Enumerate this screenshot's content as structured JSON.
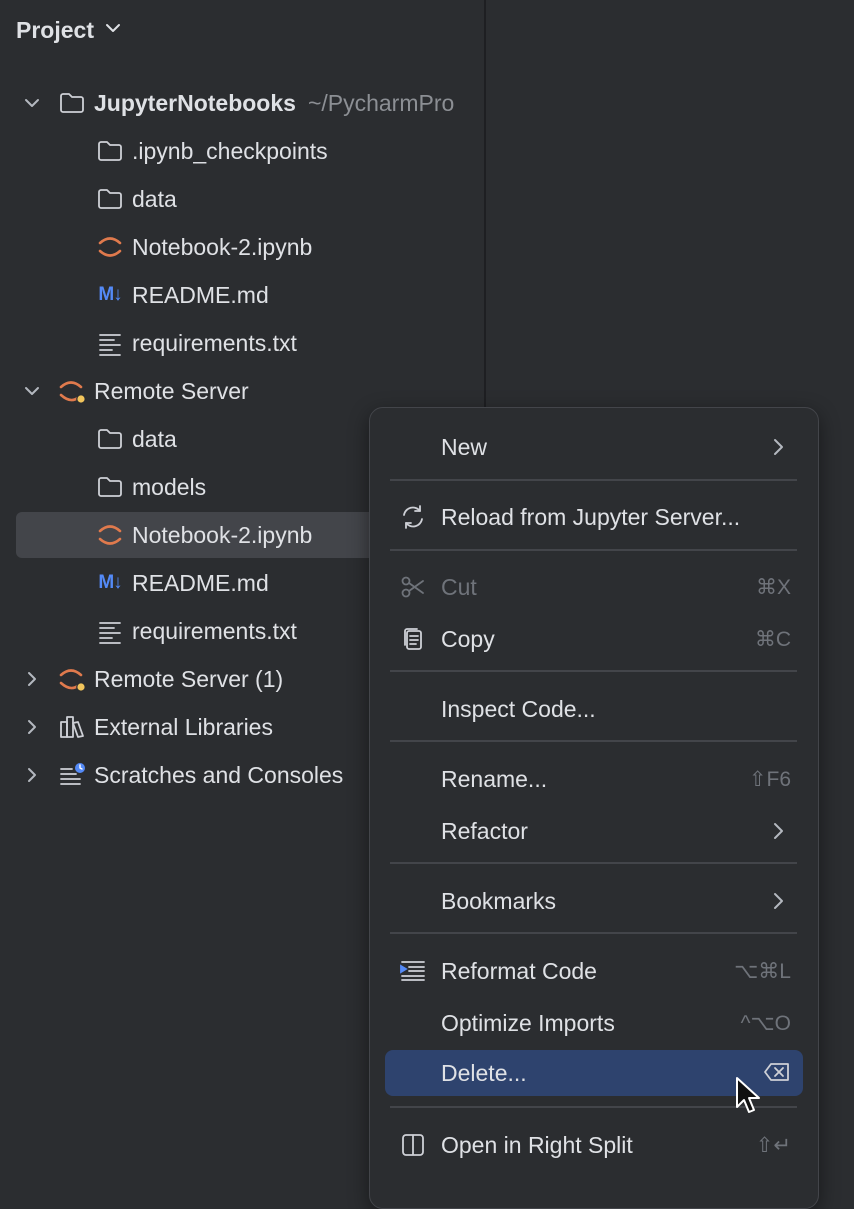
{
  "header": {
    "title": "Project"
  },
  "tree": [
    {
      "label": "JupyterNotebooks",
      "path": "~/PycharmPro",
      "icon": "folder-icon",
      "expanded": true,
      "bold": true,
      "level": 0
    },
    {
      "label": ".ipynb_checkpoints",
      "icon": "folder-icon",
      "level": 1
    },
    {
      "label": "data",
      "icon": "folder-icon",
      "level": 1
    },
    {
      "label": "Notebook-2.ipynb",
      "icon": "jupyter-icon",
      "level": 1
    },
    {
      "label": "README.md",
      "icon": "markdown-icon",
      "level": 1
    },
    {
      "label": "requirements.txt",
      "icon": "text-file-icon",
      "level": 1
    },
    {
      "label": "Remote Server",
      "icon": "jupyter-server-icon",
      "expanded": true,
      "level": 0
    },
    {
      "label": "data",
      "icon": "folder-icon",
      "level": 1
    },
    {
      "label": "models",
      "icon": "folder-icon",
      "level": 1
    },
    {
      "label": "Notebook-2.ipynb",
      "icon": "jupyter-icon",
      "level": 1,
      "selected": true
    },
    {
      "label": "README.md",
      "icon": "markdown-icon",
      "level": 1
    },
    {
      "label": "requirements.txt",
      "icon": "text-file-icon",
      "level": 1
    },
    {
      "label": "Remote Server (1)",
      "icon": "jupyter-server-icon",
      "expanded": false,
      "level": 0
    },
    {
      "label": "External Libraries",
      "icon": "library-icon",
      "expanded": false,
      "level": 0
    },
    {
      "label": "Scratches and Consoles",
      "icon": "scratches-icon",
      "expanded": false,
      "level": 0
    }
  ],
  "markdown_glyph": "M↓",
  "context_menu": {
    "new": {
      "label": "New"
    },
    "reload": {
      "label": "Reload from Jupyter Server..."
    },
    "cut": {
      "label": "Cut",
      "shortcut": "⌘X"
    },
    "copy": {
      "label": "Copy",
      "shortcut": "⌘C"
    },
    "inspect": {
      "label": "Inspect Code..."
    },
    "rename": {
      "label": "Rename...",
      "shortcut": "⇧F6"
    },
    "refactor": {
      "label": "Refactor"
    },
    "bookmarks": {
      "label": "Bookmarks"
    },
    "reformat": {
      "label": "Reformat Code",
      "shortcut": "⌥⌘L"
    },
    "optimize": {
      "label": "Optimize Imports",
      "shortcut": "^⌥O"
    },
    "delete": {
      "label": "Delete..."
    },
    "open_split": {
      "label": "Open in Right Split",
      "shortcut": "⇧↵"
    }
  },
  "colors": {
    "accent": "#548af7",
    "jupyter": "#e07a4d",
    "badge": "#f2c55c",
    "selection": "#2e436e"
  }
}
